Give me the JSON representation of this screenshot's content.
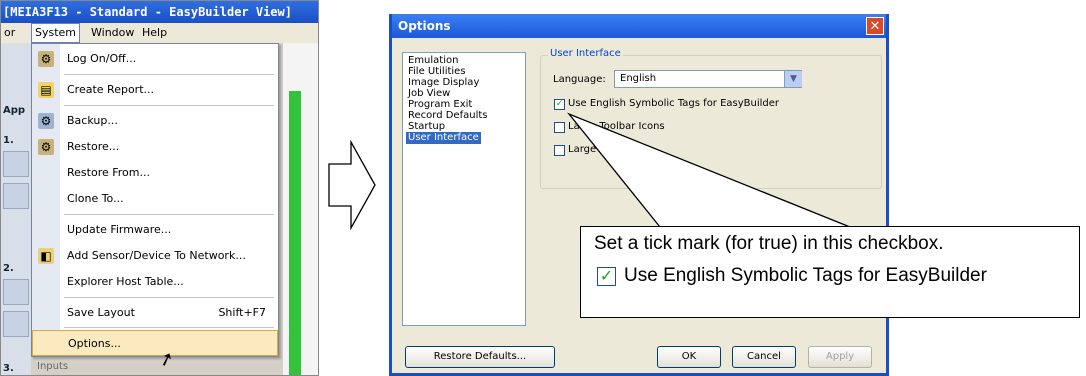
{
  "left_window": {
    "title": "[MEIA3F13 - Standard - EasyBuilder View]",
    "menubar": [
      "or",
      "System",
      "Window",
      "Help"
    ],
    "side_labels": [
      "App",
      "1.",
      "2.",
      "3."
    ],
    "inputs_label": "Inputs",
    "system_menu": [
      {
        "label": "Log On/Off...",
        "icon": "log-on-off-icon",
        "glyph": "⚙"
      },
      {
        "label": "Create Report...",
        "icon": "report-icon",
        "glyph": "▤"
      },
      {
        "label": "Backup...",
        "icon": "backup-icon",
        "glyph": "⚙"
      },
      {
        "label": "Restore...",
        "icon": "restore-icon",
        "glyph": "⚙"
      },
      {
        "label": "Restore From...",
        "icon": "",
        "glyph": ""
      },
      {
        "label": "Clone To...",
        "icon": "",
        "glyph": ""
      },
      {
        "label": "Update Firmware...",
        "icon": "",
        "glyph": ""
      },
      {
        "label": "Add Sensor/Device To Network...",
        "icon": "add-device-icon",
        "glyph": "◧"
      },
      {
        "label": "Explorer Host Table...",
        "icon": "",
        "glyph": ""
      },
      {
        "label": "Save Layout",
        "shortcut": "Shift+F7",
        "icon": "",
        "glyph": ""
      },
      {
        "label": "Options...",
        "icon": "",
        "glyph": "",
        "highlighted": true
      }
    ]
  },
  "dialog": {
    "title": "Options",
    "close": "✕",
    "categories": [
      "Emulation",
      "File Utilities",
      "Image Display",
      "Job View",
      "Program Exit",
      "Record Defaults",
      "Startup",
      "User Interface"
    ],
    "selected_category": "User Interface",
    "group_title": "User Interface",
    "language_label": "Language:",
    "language_value": "English",
    "checkboxes": [
      {
        "label": "Use English Symbolic Tags for EasyBuilder",
        "checked": true
      },
      {
        "label": "Large Toolbar Icons",
        "checked": false
      },
      {
        "label": "Large Tree Icons",
        "checked": false
      }
    ],
    "buttons": {
      "restore": "Restore Defaults...",
      "ok": "OK",
      "cancel": "Cancel",
      "apply": "Apply"
    }
  },
  "callout": {
    "text": "Set a tick mark (for true) in this checkbox.",
    "checkbox_label": "Use English Symbolic Tags for EasyBuilder",
    "checked": true
  },
  "colors": {
    "title_blue": "#1a4fc4",
    "dialog_bg": "#ece9d8",
    "highlight": "#fbe9bf",
    "selection": "#316ac5",
    "check_green": "#21a121"
  }
}
